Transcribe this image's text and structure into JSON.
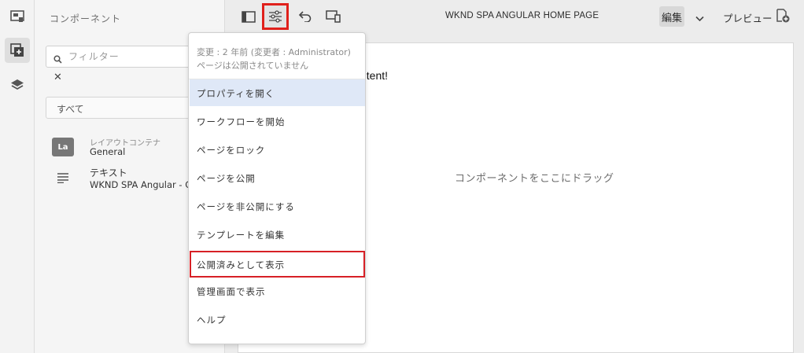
{
  "rail": {
    "icons": [
      "page-info-icon",
      "components-icon",
      "layers-icon"
    ]
  },
  "sidebar": {
    "title": "コンポーネント",
    "filter_placeholder": "フィルター",
    "clear_label": "✕",
    "group_select": "すべて",
    "components": [
      {
        "badge": "La",
        "small_label": "レイアウトコンテナ",
        "label": "General"
      },
      {
        "icon": "text-lines-icon",
        "label": "テキスト",
        "sub_label": "WKND SPA Angular - Co"
      }
    ]
  },
  "toolbar": {
    "page_title": "WKND SPA ANGULAR HOME PAGE",
    "mode_label": "編集",
    "preview_label": "プレビュー",
    "highlight_color": "#e0201b"
  },
  "canvas": {
    "content_text": "ntent!",
    "drop_hint": "コンポーネントをここにドラッグ"
  },
  "page_menu": {
    "status_line1": "変更 : 2 年前 (変更者 : Administrator)",
    "status_line2": "ページは公開されていません",
    "items": [
      "プロパティを開く",
      "ワークフローを開始",
      "ページをロック",
      "ページを公開",
      "ページを非公開にする",
      "テンプレートを編集",
      "公開済みとして表示",
      "管理画面で表示",
      "ヘルプ"
    ],
    "active_item": "プロパティを開く",
    "highlighted_item": "公開済みとして表示",
    "highlight_color": "#d72026"
  }
}
